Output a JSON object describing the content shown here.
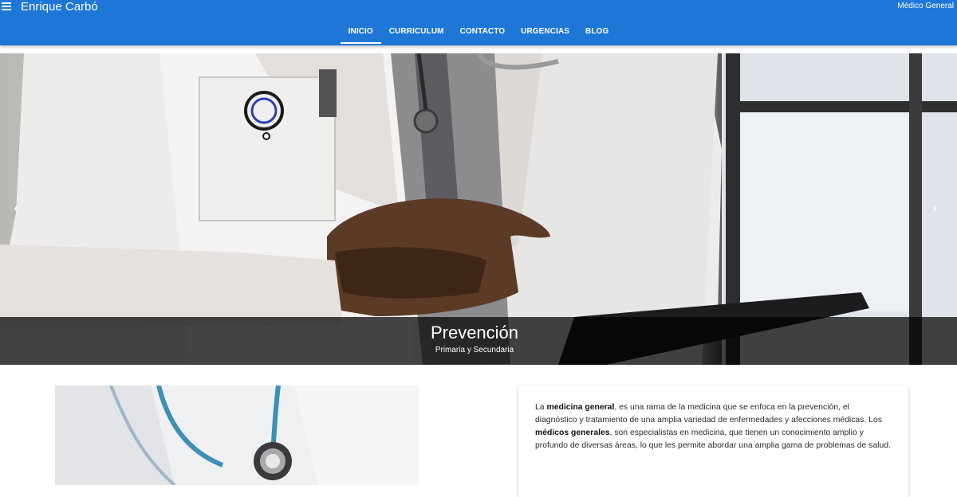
{
  "header": {
    "title": "Enrique Carbó",
    "tagline": "Médico General",
    "menu_icon": "hamburger-menu-icon"
  },
  "nav": {
    "items": [
      {
        "label": "INICIO",
        "active": true
      },
      {
        "label": "CURRICULUM",
        "active": false
      },
      {
        "label": "CONTACTO",
        "active": false
      },
      {
        "label": "URGENCIAS",
        "active": false
      },
      {
        "label": "BLOG",
        "active": false
      }
    ]
  },
  "carousel": {
    "slide_title": "Prevención",
    "slide_subtitle": "Primaria y Secundaria",
    "prev_icon": "chevron-left-icon",
    "prev_glyph": "‹",
    "next_icon": "chevron-right-icon",
    "next_glyph": "›"
  },
  "intro": {
    "p1_a": "La ",
    "p1_b": "medicina general",
    "p1_c": ", es una rama de la medicina que se enfoca en la prevención, el diagnóstico y tratamiento de una amplia variedad de enfermedades y afecciones médicas. Los ",
    "p1_d": "médicos generales",
    "p1_e": ", son especialistas en medicina, que tienen un conocimiento amplio y profundo de diversas áreas, lo que les permite abordar una amplia gama de problemas de salud."
  },
  "colors": {
    "primary": "#1e76d6",
    "caption_overlay": "#000000"
  }
}
